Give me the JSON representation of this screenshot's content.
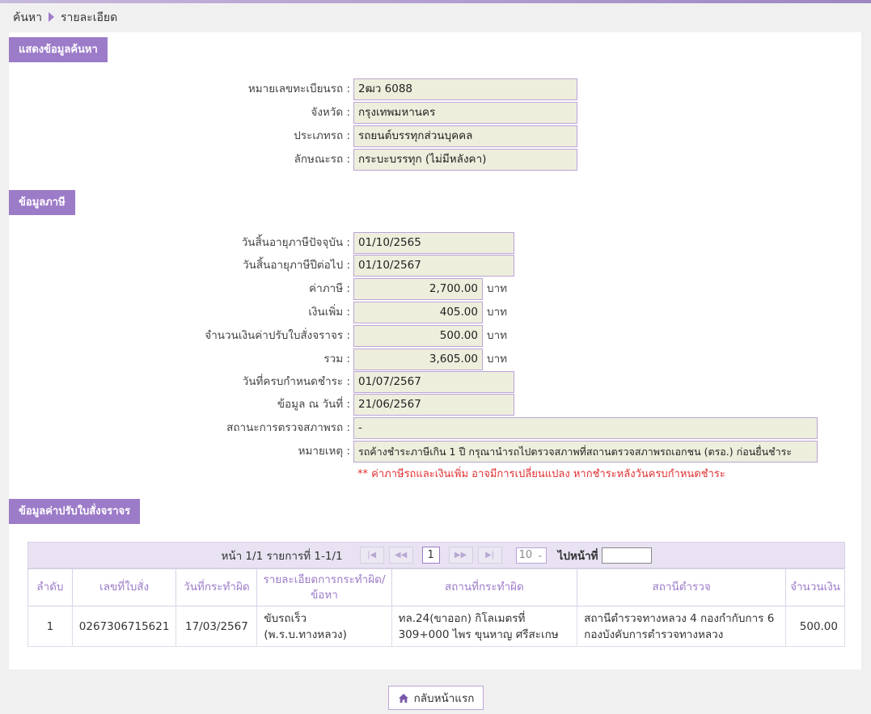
{
  "breadcrumb": {
    "search": "ค้นหา",
    "detail": "รายละเอียด"
  },
  "search_section": {
    "title": "แสดงข้อมูลค้นหา",
    "fields": [
      {
        "label": "หมายเลขทะเบียนรถ :",
        "value": "2ฒว 6088"
      },
      {
        "label": "จังหวัด :",
        "value": "กรุงเทพมหานคร"
      },
      {
        "label": "ประเภทรถ :",
        "value": "รถยนต์บรรทุกส่วนบุคคล"
      },
      {
        "label": "ลักษณะรถ :",
        "value": "กระบะบรรทุก (ไม่มีหลังคา)"
      }
    ]
  },
  "tax_section": {
    "title": "ข้อมูลภาษี",
    "current_expiry": {
      "label": "วันสิ้นอายุภาษีปัจจุบัน :",
      "value": "01/10/2565"
    },
    "next_expiry": {
      "label": "วันสิ้นอายุภาษีปีต่อไป :",
      "value": "01/10/2567"
    },
    "tax": {
      "label": "ค่าภาษี :",
      "value": "2,700.00",
      "unit": "บาท"
    },
    "surcharge": {
      "label": "เงินเพิ่ม :",
      "value": "405.00",
      "unit": "บาท"
    },
    "fine_amount": {
      "label": "จำนวนเงินค่าปรับใบสั่งจราจร :",
      "value": "500.00",
      "unit": "บาท"
    },
    "total": {
      "label": "รวม :",
      "value": "3,605.00",
      "unit": "บาท"
    },
    "due_date": {
      "label": "วันที่ครบกำหนดชำระ :",
      "value": "01/07/2567"
    },
    "as_of": {
      "label": "ข้อมูล ณ วันที่ :",
      "value": "21/06/2567"
    },
    "inspection": {
      "label": "สถานะการตรวจสภาพรถ :",
      "value": "-"
    },
    "remark": {
      "label": "หมายเหตุ :",
      "value": "รถค้างชำระภาษีเกิน 1 ปี กรุณานำรถไปตรวจสภาพที่สถานตรวจสภาพรถเอกชน (ตรอ.) ก่อนยื่นชำระ"
    },
    "warning": "** ค่าภาษีรถและเงินเพิ่ม อาจมีการเปลี่ยนแปลง หากชำระหลังวันครบกำหนดชำระ"
  },
  "fine_section": {
    "title": "ข้อมูลค่าปรับใบสั่งจราจร",
    "pager": {
      "summary": "หน้า 1/1 รายการที่ 1-1/1",
      "current_page": "1",
      "page_size": "10",
      "goto_label": "ไปหน้าที่"
    },
    "columns": [
      "ลำดับ",
      "เลขที่ใบสั่ง",
      "วันที่กระทำผิด",
      "รายละเอียดการกระทำผิด/ข้อหา",
      "สถานที่กระทำผิด",
      "สถานีตำรวจ",
      "จำนวนเงิน"
    ],
    "rows": [
      {
        "no": "1",
        "ticket": "0267306715621",
        "date": "17/03/2567",
        "offense_l1": "ขับรถเร็ว",
        "offense_l2": "(พ.ร.บ.ทางหลวง)",
        "place_l1": "ทล.24(ขาออก) กิโลเมตรที่",
        "place_l2": "309+000 ไพร ขุนหาญ ศรีสะเกษ",
        "station_l1": "สถานีตำรวจทางหลวง 4 กองกำกับการ 6",
        "station_l2": "กองบังคับการตำรวจทางหลวง",
        "amount": "500.00"
      }
    ]
  },
  "home_button": {
    "label": "กลับหน้าแรก"
  },
  "colors": {
    "accent": "#9c7bc8",
    "field_bg": "#eeeedd",
    "warning": "#e03030"
  }
}
